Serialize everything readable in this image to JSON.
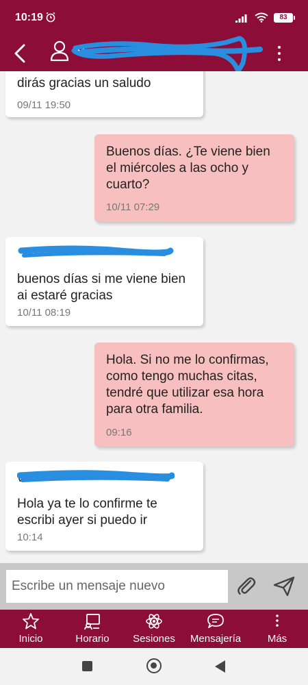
{
  "status_bar": {
    "time": "10:19",
    "battery": "83"
  },
  "header": {
    "contact_name": "Vi",
    "redaction_color": "#2a8ee0"
  },
  "messages": [
    {
      "direction": "in",
      "sender": "",
      "text": "dirás gracias un saludo",
      "time": "09/11 19:50"
    },
    {
      "direction": "out",
      "sender": "",
      "text": "Buenos días. ¿Te viene bien el miércoles a las ocho y cuarto?",
      "time": "10/11 07:29"
    },
    {
      "direction": "in",
      "sender": "",
      "text": "buenos días si me viene bien ai estaré gracias",
      "time": "10/11 08:19"
    },
    {
      "direction": "out",
      "sender": "",
      "text": "Hola. Si no me lo confirmas, como tengo muchas citas, tendré que utilizar esa hora para otra familia.",
      "time": "09:16"
    },
    {
      "direction": "in",
      "sender": "Vi",
      "text": "Hola ya te lo confirme te escribi ayer  si puedo ir",
      "time": "10:14"
    }
  ],
  "compose": {
    "placeholder": "Escribe un mensaje nuevo"
  },
  "nav": {
    "items": [
      {
        "label": "Inicio",
        "icon": "star-icon"
      },
      {
        "label": "Horario",
        "icon": "schedule-icon"
      },
      {
        "label": "Sesiones",
        "icon": "atom-icon"
      },
      {
        "label": "Mensajería",
        "icon": "chat-bubble-icon"
      },
      {
        "label": "Más",
        "icon": "more-vertical-icon"
      }
    ]
  },
  "colors": {
    "brand": "#8b0d38",
    "outgoing_bubble": "#f7bfc0",
    "incoming_bubble": "#ffffff",
    "compose_bg": "#c8c8c8"
  }
}
